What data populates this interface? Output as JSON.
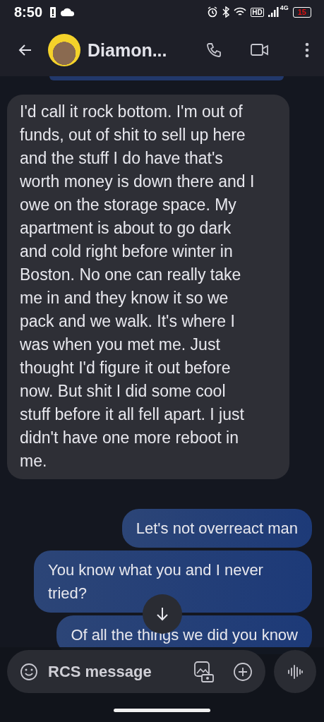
{
  "status_bar": {
    "time": "8:50",
    "hd_label": "HD",
    "network": "4G",
    "battery": "15"
  },
  "header": {
    "contact_name": "Diamon..."
  },
  "messages": [
    {
      "kind": "received",
      "text": "I'd call it rock bottom. I'm out of funds, out of shit to sell up here and the stuff I do have that's worth money is down there and I owe on the storage space. My apartment is about to go dark and cold right before winter in Boston. No one can really take me in and they know it so we pack and we walk. It's where I was when you met me. Just thought I'd figure it out before now. But shit I did some cool stuff before it all fell apart. I just didn't have one more reboot in me."
    },
    {
      "kind": "sent",
      "text": "Let's not overreact man"
    },
    {
      "kind": "sent",
      "text": "You know what you and I never tried?"
    },
    {
      "kind": "sent",
      "text": "Of all the things we did you know"
    }
  ],
  "composer": {
    "placeholder": "RCS message"
  }
}
